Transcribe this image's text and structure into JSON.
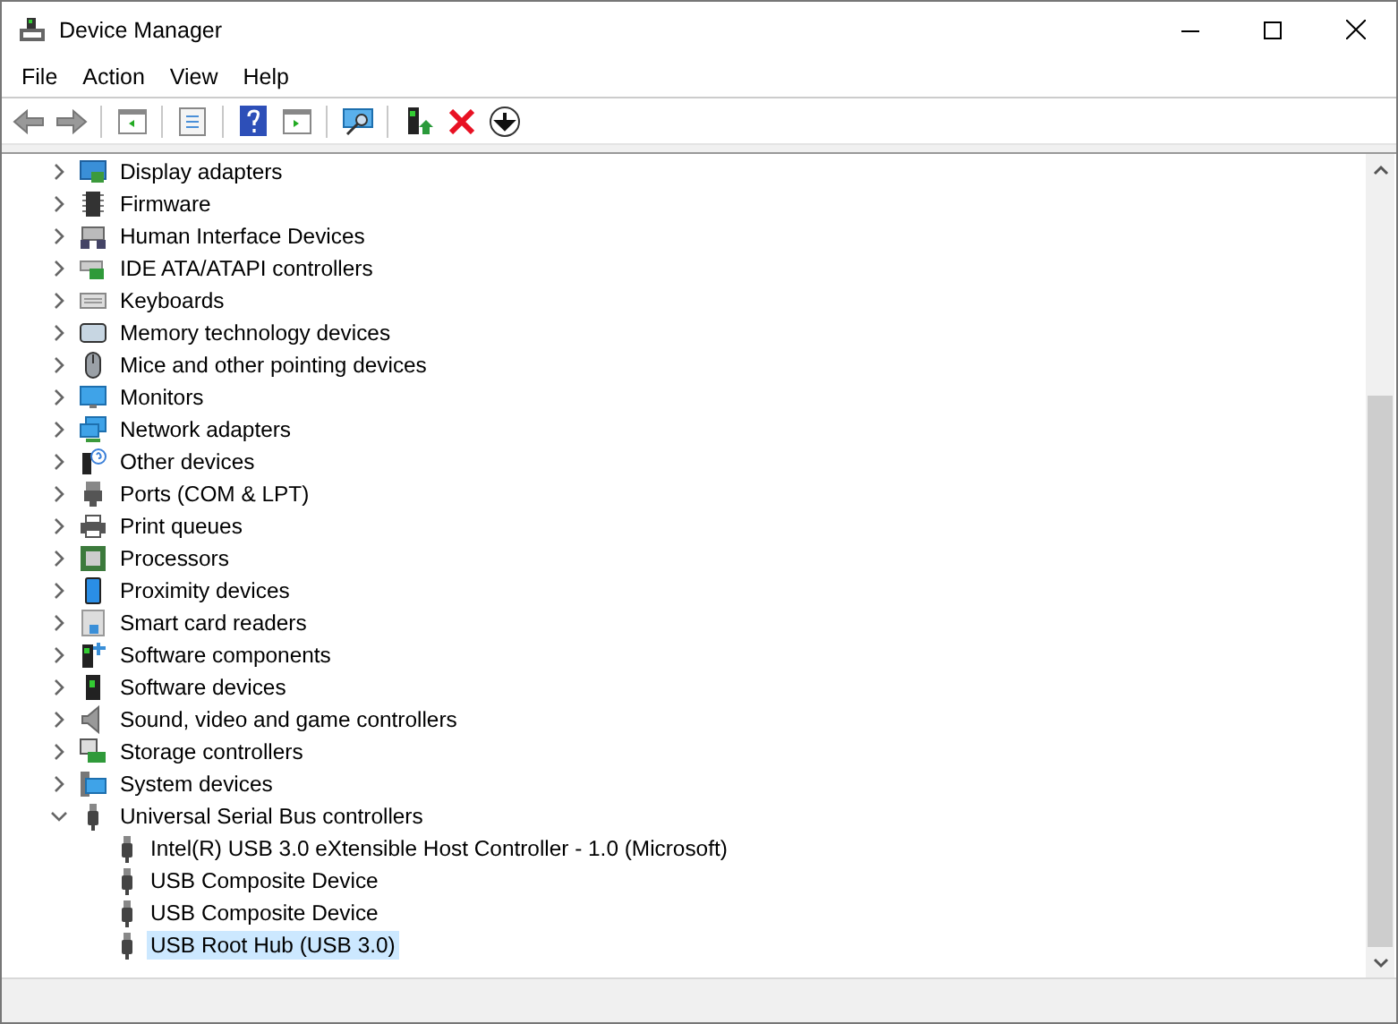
{
  "window": {
    "title": "Device Manager"
  },
  "menu": [
    "File",
    "Action",
    "View",
    "Help"
  ],
  "tree": [
    {
      "label": "Display adapters",
      "kind": "display",
      "expanded": false,
      "selected": false
    },
    {
      "label": "Firmware",
      "kind": "chip",
      "expanded": false,
      "selected": false
    },
    {
      "label": "Human Interface Devices",
      "kind": "hid",
      "expanded": false,
      "selected": false
    },
    {
      "label": "IDE ATA/ATAPI controllers",
      "kind": "controller",
      "expanded": false,
      "selected": false
    },
    {
      "label": "Keyboards",
      "kind": "keyboard",
      "expanded": false,
      "selected": false
    },
    {
      "label": "Memory technology devices",
      "kind": "memory",
      "expanded": false,
      "selected": false
    },
    {
      "label": "Mice and other pointing devices",
      "kind": "mouse",
      "expanded": false,
      "selected": false
    },
    {
      "label": "Monitors",
      "kind": "monitor",
      "expanded": false,
      "selected": false
    },
    {
      "label": "Network adapters",
      "kind": "network",
      "expanded": false,
      "selected": false
    },
    {
      "label": "Other devices",
      "kind": "unknown",
      "expanded": false,
      "selected": false
    },
    {
      "label": "Ports (COM & LPT)",
      "kind": "port",
      "expanded": false,
      "selected": false
    },
    {
      "label": "Print queues",
      "kind": "printer",
      "expanded": false,
      "selected": false
    },
    {
      "label": "Processors",
      "kind": "cpu",
      "expanded": false,
      "selected": false
    },
    {
      "label": "Proximity devices",
      "kind": "phone",
      "expanded": false,
      "selected": false
    },
    {
      "label": "Smart card readers",
      "kind": "card",
      "expanded": false,
      "selected": false
    },
    {
      "label": "Software components",
      "kind": "component",
      "expanded": false,
      "selected": false
    },
    {
      "label": "Software devices",
      "kind": "tower",
      "expanded": false,
      "selected": false
    },
    {
      "label": "Sound, video and game controllers",
      "kind": "speaker",
      "expanded": false,
      "selected": false
    },
    {
      "label": "Storage controllers",
      "kind": "storage",
      "expanded": false,
      "selected": false
    },
    {
      "label": "System devices",
      "kind": "system",
      "expanded": false,
      "selected": false
    },
    {
      "label": "Universal Serial Bus controllers",
      "kind": "usb",
      "expanded": true,
      "selected": false,
      "children": [
        {
          "label": "Intel(R) USB 3.0 eXtensible Host Controller - 1.0 (Microsoft)",
          "kind": "usb",
          "selected": false
        },
        {
          "label": "USB Composite Device",
          "kind": "usb",
          "selected": false
        },
        {
          "label": "USB Composite Device",
          "kind": "usb",
          "selected": false
        },
        {
          "label": "USB Root Hub (USB 3.0)",
          "kind": "usb",
          "selected": true
        }
      ]
    }
  ]
}
